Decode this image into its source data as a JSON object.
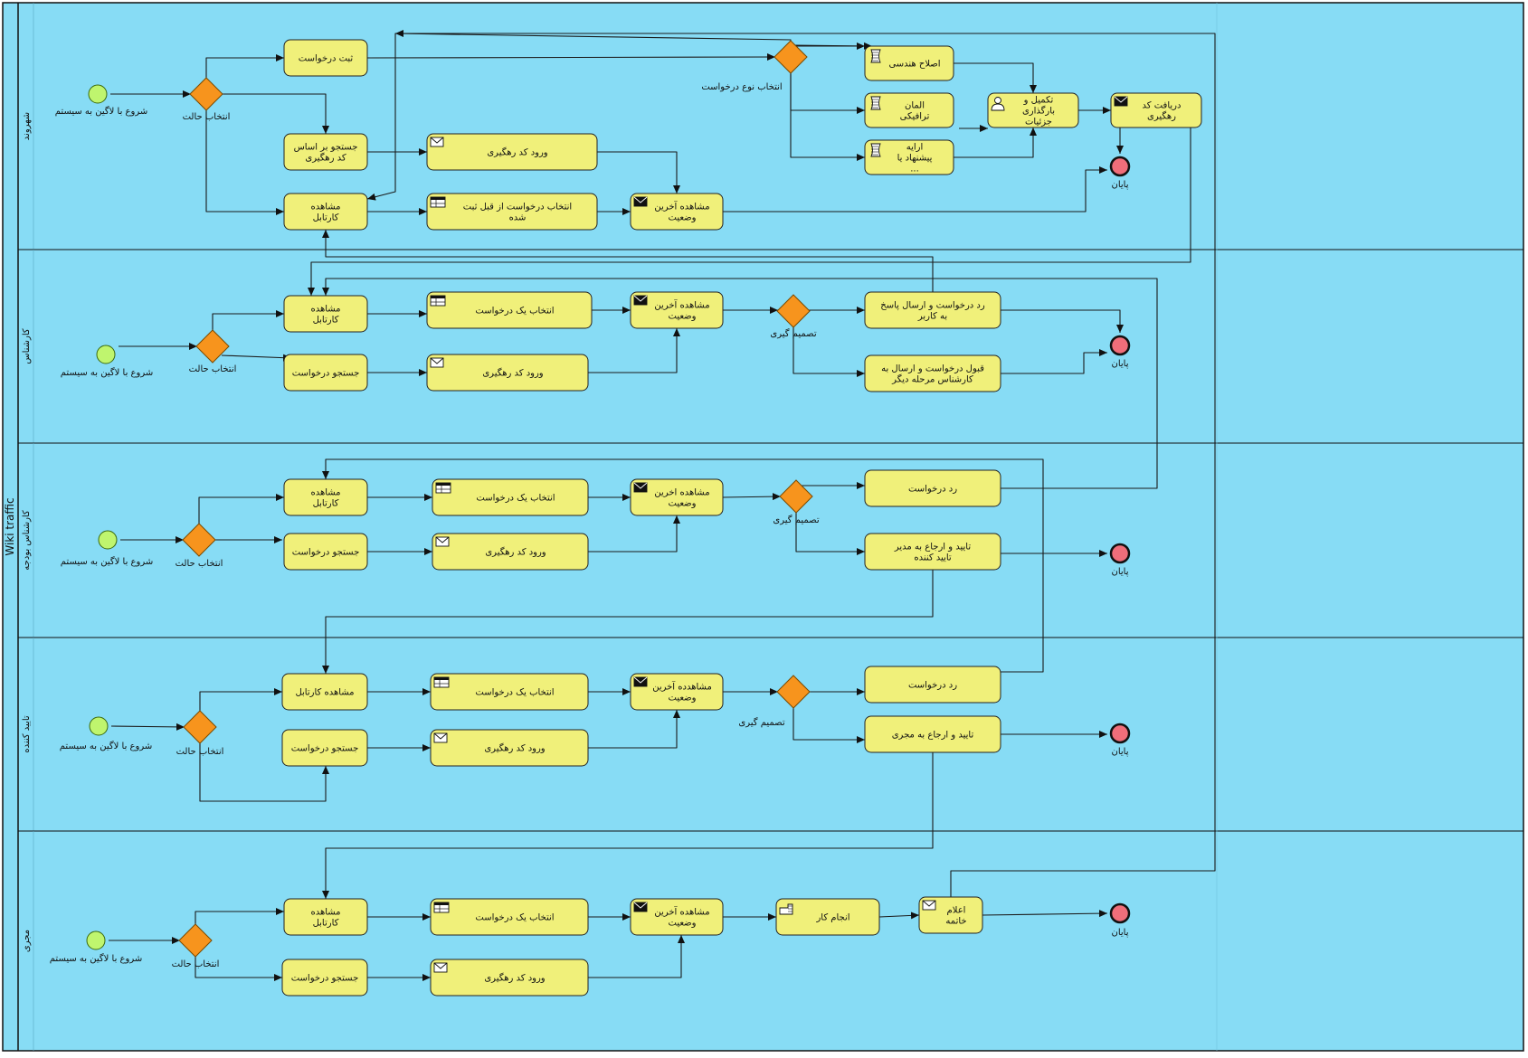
{
  "pool": {
    "title": "Wiki traffic",
    "lanes": [
      {
        "id": "L1",
        "label": "شهروند"
      },
      {
        "id": "L2",
        "label": "کارشناس"
      },
      {
        "id": "L3",
        "label": "کارشناس بودجه"
      },
      {
        "id": "L4",
        "label": "تایید کننده"
      },
      {
        "id": "L5",
        "label": "مجری"
      }
    ]
  },
  "colors": {
    "lane_bg": "#87dcf5",
    "task_fill": "#f0f07a",
    "gateway_fill": "#f7941d",
    "start_fill": "#bff56e",
    "end_fill": "#f06e7a",
    "line": "#1a1a1a"
  },
  "nodes": [
    {
      "id": "s1",
      "type": "start",
      "label": "شروع با لاگین به سیستم"
    },
    {
      "id": "g1",
      "type": "gateway",
      "label": "انتخاب حالت"
    },
    {
      "id": "t1a",
      "type": "task",
      "label": "ثبت درخواست"
    },
    {
      "id": "t1b",
      "type": "task",
      "label": "جستجو بر اساس کد رهگیری"
    },
    {
      "id": "t1c",
      "type": "task",
      "label": "مشاهده کارتابل"
    },
    {
      "id": "t1d",
      "type": "task",
      "icon": "envelope-icon",
      "label": "ورود کد رهگیری"
    },
    {
      "id": "t1e",
      "type": "task",
      "icon": "table-icon",
      "label": "انتخاب درخواست از قبل ثبت شده"
    },
    {
      "id": "t1f",
      "type": "task",
      "icon": "envelope-filled-icon",
      "label": "مشاهده آخرین وضعیت"
    },
    {
      "id": "g1b",
      "type": "gateway",
      "label": "انتخاب نوع درخواست"
    },
    {
      "id": "t1g",
      "type": "task",
      "icon": "script-icon",
      "label": "اصلاح هندسی"
    },
    {
      "id": "t1h",
      "type": "task",
      "icon": "script-icon",
      "label": "المان ترافیکی"
    },
    {
      "id": "t1i",
      "type": "task",
      "icon": "script-icon",
      "label": "ارایه پیشنهاد یا ..."
    },
    {
      "id": "t1j",
      "type": "task",
      "icon": "user-icon",
      "label": "تکمیل و بارگذاری جزئیات"
    },
    {
      "id": "t1k",
      "type": "task",
      "icon": "envelope-filled-icon",
      "label": "دریافت کد رهگیری"
    },
    {
      "id": "e1",
      "type": "end",
      "label": "پایان"
    },
    {
      "id": "s2",
      "type": "start",
      "label": "شروع با لاگین به سیستم"
    },
    {
      "id": "g2",
      "type": "gateway",
      "label": "انتخاب حالت"
    },
    {
      "id": "t2a",
      "type": "task",
      "label": "مشاهده کارتابل"
    },
    {
      "id": "t2b",
      "type": "task",
      "label": "جستجو درخواست"
    },
    {
      "id": "t2c",
      "type": "task",
      "icon": "table-icon",
      "label": "انتخاب یک درخواست"
    },
    {
      "id": "t2d",
      "type": "task",
      "icon": "envelope-icon",
      "label": "ورود کد رهگیری"
    },
    {
      "id": "t2e",
      "type": "task",
      "icon": "envelope-filled-icon",
      "label": "مشاهده آخرین وضعیت"
    },
    {
      "id": "g2b",
      "type": "gateway",
      "label": "تصمیم گیری"
    },
    {
      "id": "t2f",
      "type": "task",
      "label": "رد درخواست و ارسال پاسخ به کاربر"
    },
    {
      "id": "t2g",
      "type": "task",
      "label": "قبول درخواست و ارسال به کارشناس مرحله دیگر"
    },
    {
      "id": "e2",
      "type": "end",
      "label": "پایان"
    },
    {
      "id": "s3",
      "type": "start",
      "label": "شروع با لاگین به سیستم"
    },
    {
      "id": "g3",
      "type": "gateway",
      "label": "انتخاب حالت"
    },
    {
      "id": "t3a",
      "type": "task",
      "label": "مشاهده کارتابل"
    },
    {
      "id": "t3b",
      "type": "task",
      "label": "جستجو درخواست"
    },
    {
      "id": "t3c",
      "type": "task",
      "icon": "table-icon",
      "label": "انتخاب یک درخواست"
    },
    {
      "id": "t3d",
      "type": "task",
      "icon": "envelope-icon",
      "label": "ورود کد رهگیری"
    },
    {
      "id": "t3e",
      "type": "task",
      "icon": "envelope-filled-icon",
      "label": "مشاهده اخرین وضعیت"
    },
    {
      "id": "g3b",
      "type": "gateway",
      "label": "تصمیم گیری"
    },
    {
      "id": "t3f",
      "type": "task",
      "label": "رد درخواست"
    },
    {
      "id": "t3g",
      "type": "task",
      "label": "تایید و ارجاع به مدیر تایید کننده"
    },
    {
      "id": "e3",
      "type": "end",
      "label": "پایان"
    },
    {
      "id": "s4",
      "type": "start",
      "label": "شروع با لاگین به سیستم"
    },
    {
      "id": "g4",
      "type": "gateway",
      "label": "انتخاب حالت"
    },
    {
      "id": "t4a",
      "type": "task",
      "label": "مشاهده کارتابل"
    },
    {
      "id": "t4b",
      "type": "task",
      "label": "جستجو درخواست"
    },
    {
      "id": "t4c",
      "type": "task",
      "icon": "table-icon",
      "label": "انتخاب یک درخواست"
    },
    {
      "id": "t4d",
      "type": "task",
      "icon": "envelope-icon",
      "label": "ورود کد رهگیری"
    },
    {
      "id": "t4e",
      "type": "task",
      "icon": "envelope-filled-icon",
      "label": "مشاهدده آخرین وضعیت"
    },
    {
      "id": "g4b",
      "type": "gateway",
      "label": "تصمیم گیری"
    },
    {
      "id": "t4f",
      "type": "task",
      "label": "رد درخواست"
    },
    {
      "id": "t4g",
      "type": "task",
      "label": "تایید و ارجاع به مجری"
    },
    {
      "id": "e4",
      "type": "end",
      "label": "پایان"
    },
    {
      "id": "s5",
      "type": "start",
      "label": "شروع با لاگین به سیستم"
    },
    {
      "id": "g5",
      "type": "gateway",
      "label": "انتخاب حالت"
    },
    {
      "id": "t5a",
      "type": "task",
      "label": "مشاهده کارتابل"
    },
    {
      "id": "t5b",
      "type": "task",
      "label": "جستجو درخواست"
    },
    {
      "id": "t5c",
      "type": "task",
      "icon": "table-icon",
      "label": "انتخاب یک درخواست"
    },
    {
      "id": "t5d",
      "type": "task",
      "icon": "envelope-icon",
      "label": "ورود کد رهگیری"
    },
    {
      "id": "t5e",
      "type": "task",
      "icon": "envelope-filled-icon",
      "label": "مشاهده آخرین وضعیت"
    },
    {
      "id": "t5f",
      "type": "task",
      "icon": "hand-icon",
      "label": "انجام کار"
    },
    {
      "id": "t5g",
      "type": "task",
      "icon": "envelope-icon",
      "label": "اعلام خاتمه"
    },
    {
      "id": "e5",
      "type": "end",
      "label": "پایان"
    }
  ]
}
